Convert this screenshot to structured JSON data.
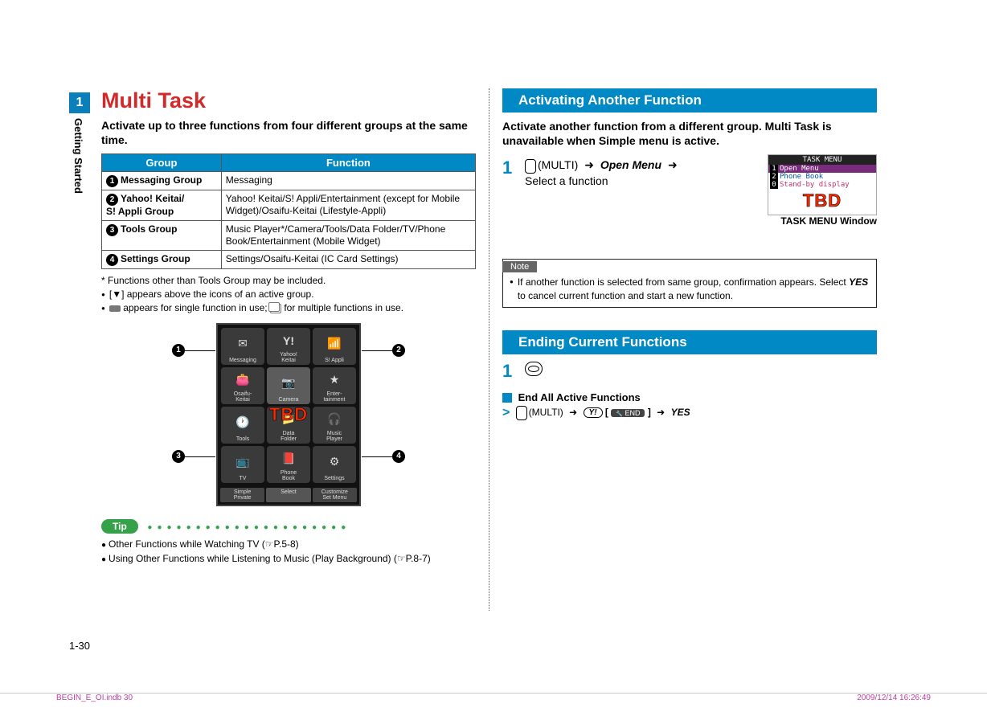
{
  "chapter": {
    "number": "1",
    "name": "Getting Started"
  },
  "left": {
    "title": "Multi Task",
    "intro": "Activate up to three functions from four different groups at the same time.",
    "table": {
      "head": [
        "Group",
        "Function"
      ],
      "rows": [
        {
          "n": "1",
          "group": "Messaging Group",
          "func": "Messaging"
        },
        {
          "n": "2",
          "group": "Yahoo! Keitai/\nS! Appli Group",
          "func": "Yahoo! Keitai/S! Appli/Entertainment (except for Mobile Widget)/Osaifu-Keitai (Lifestyle-Appli)"
        },
        {
          "n": "3",
          "group": "Tools Group",
          "func": "Music Player*/Camera/Tools/Data Folder/TV/Phone Book/Entertainment (Mobile Widget)"
        },
        {
          "n": "4",
          "group": "Settings Group",
          "func": "Settings/Osaifu-Keitai (IC Card Settings)"
        }
      ]
    },
    "footnote": "* Functions other than Tools Group may be included.",
    "bul1a": "[",
    "bul1b": "] appears above the icons of an active group.",
    "bul2a": " appears for single function in use; ",
    "bul2b": " for multiple functions in use.",
    "screenshot": {
      "icons": [
        "Messaging",
        "Yahoo!\nKeitai",
        "S! Appli",
        "Osaifu-\nKeitai",
        "Camera",
        "Enter-\ntainment",
        "Tools",
        "Data\nFolder",
        "Music\nPlayer",
        "TV",
        "Phone\nBook",
        "Settings"
      ],
      "softkeys": [
        "Simple",
        "Select",
        "Customize"
      ],
      "softkeys2": [
        "Private",
        "",
        "Set Menu"
      ],
      "tbd": "TBD",
      "callouts": [
        "1",
        "2",
        "3",
        "4"
      ]
    },
    "tip": {
      "label": "Tip",
      "items": [
        "Other Functions while Watching TV (☞P.5-8)",
        "Using Other Functions while Listening to Music (Play Background) (☞P.8-7)"
      ]
    }
  },
  "right": {
    "sec1": {
      "title": "Activating Another Function",
      "intro": "Activate another function from a different group. Multi Task is unavailable when Simple menu is active.",
      "step1_key": "(MULTI)",
      "step1_cmd": "Open Menu",
      "step1_post": "Select a function",
      "task_window": {
        "title": "TASK MENU",
        "rows": [
          {
            "n": "1",
            "text": "Open Menu",
            "cls": "sel"
          },
          {
            "n": "2",
            "text": "Phone Book",
            "cls": "blue"
          },
          {
            "n": "0",
            "text": "Stand-by display",
            "cls": "pink"
          }
        ],
        "tbd": "TBD",
        "caption": "TASK MENU Window"
      },
      "note": {
        "label": "Note",
        "body_pre": "If another function is selected from same group, confirmation appears. Select ",
        "body_yes": "YES",
        "body_post": " to cancel current function and start a new function."
      }
    },
    "sec2": {
      "title": "Ending Current Functions",
      "end_all": "End All Active Functions",
      "seq_key": "(MULTI)",
      "seq_end": "END",
      "seq_yes": "YES"
    }
  },
  "page_num": "1-30",
  "footer": {
    "left": "BEGIN_E_OI.indb   30",
    "right": "2009/12/14   16:26:49"
  }
}
